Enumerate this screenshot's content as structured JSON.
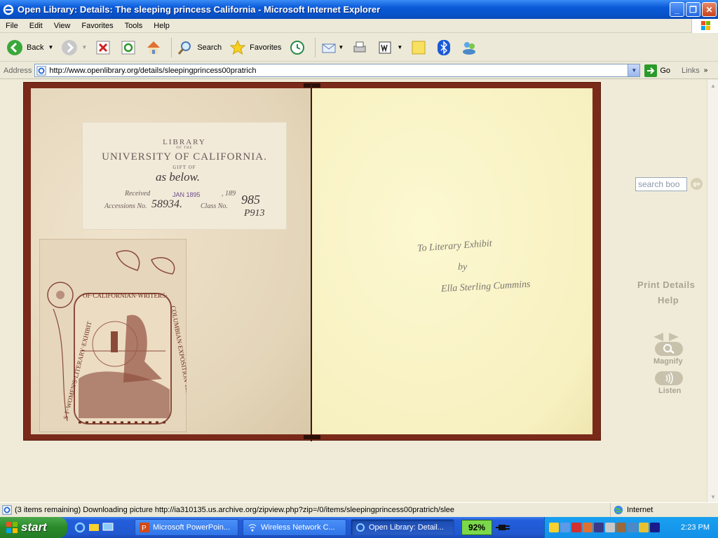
{
  "window": {
    "title": "Open Library: Details: The sleeping princess California - Microsoft Internet Explorer",
    "minimize": "_",
    "maximize": "❐",
    "close": "✕"
  },
  "menu": [
    "File",
    "Edit",
    "View",
    "Favorites",
    "Tools",
    "Help"
  ],
  "toolbar": {
    "back": "Back",
    "search": "Search",
    "favorites": "Favorites"
  },
  "address": {
    "label": "Address",
    "url": "http://www.openlibrary.org/details/sleepingprincess00pratrich",
    "go": "Go",
    "links": "Links"
  },
  "book": {
    "library_label": {
      "line1": "LIBRARY",
      "line2": "OF THE",
      "line3": "UNIVERSITY OF CALIFORNIA.",
      "line4": "GIFT OF",
      "line5": "as below.",
      "received": "Received",
      "received_stamp": "JAN 1895",
      "year": ", 189",
      "accessions": "Accessions No.",
      "accession_number": "58934.",
      "class_no": "Class No.",
      "class_number": "985",
      "class_number2": "P913"
    },
    "bookplate": {
      "arc_top": "OF·CALIFORNIAN·WRITERS·",
      "left_side": "S·F·WOMEN'S·LITERARY·EXHIBIT",
      "right_side": "COLUMBIAN·EXPOSITION·1893"
    },
    "inscription": {
      "line1": "To Literary Exhibit",
      "line2": "by",
      "line3": "Ella Sterling Cummins"
    }
  },
  "sidebar": {
    "search_placeholder": "search boo",
    "go_label": "go",
    "print_details": "Print Details",
    "help": "Help",
    "magnify": "Magnify",
    "listen": "Listen"
  },
  "status": {
    "message": "(3 items remaining) Downloading picture http://ia310135.us.archive.org/zipview.php?zip=/0/items/sleepingprincess00pratrich/slee",
    "zone": "Internet"
  },
  "taskbar": {
    "start": "start",
    "tasks": [
      "Microsoft PowerPoin...",
      "Wireless Network C...",
      "Open Library: Detail..."
    ],
    "battery": "92%",
    "clock": "2:23 PM"
  }
}
